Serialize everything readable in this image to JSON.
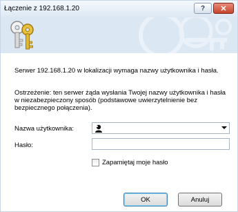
{
  "window": {
    "title": "Łączenie z 192.168.1.20",
    "help_glyph": "?",
    "close_glyph": "✕",
    "banner_icon": "keys-icon"
  },
  "dialog": {
    "prompt": "Serwer 192.168.1.20 w lokalizacji  wymaga nazwy użytkownika i hasła.",
    "warning": "Ostrzeżenie: ten serwer żąda wysłania Twojej nazwy użytkownika i hasła w niezabezpieczony sposób (podstawowe uwierzytelnienie bez bezpiecznego połączenia).",
    "username_label": "Nazwa użytkownika:",
    "username_value": "",
    "username_icon": "user-silhouette-icon",
    "password_label": "Hasło:",
    "password_value": "",
    "remember_label": "Zapamiętaj moje hasło",
    "remember_checked": false,
    "ok_label": "OK",
    "cancel_label": "Anuluj"
  }
}
